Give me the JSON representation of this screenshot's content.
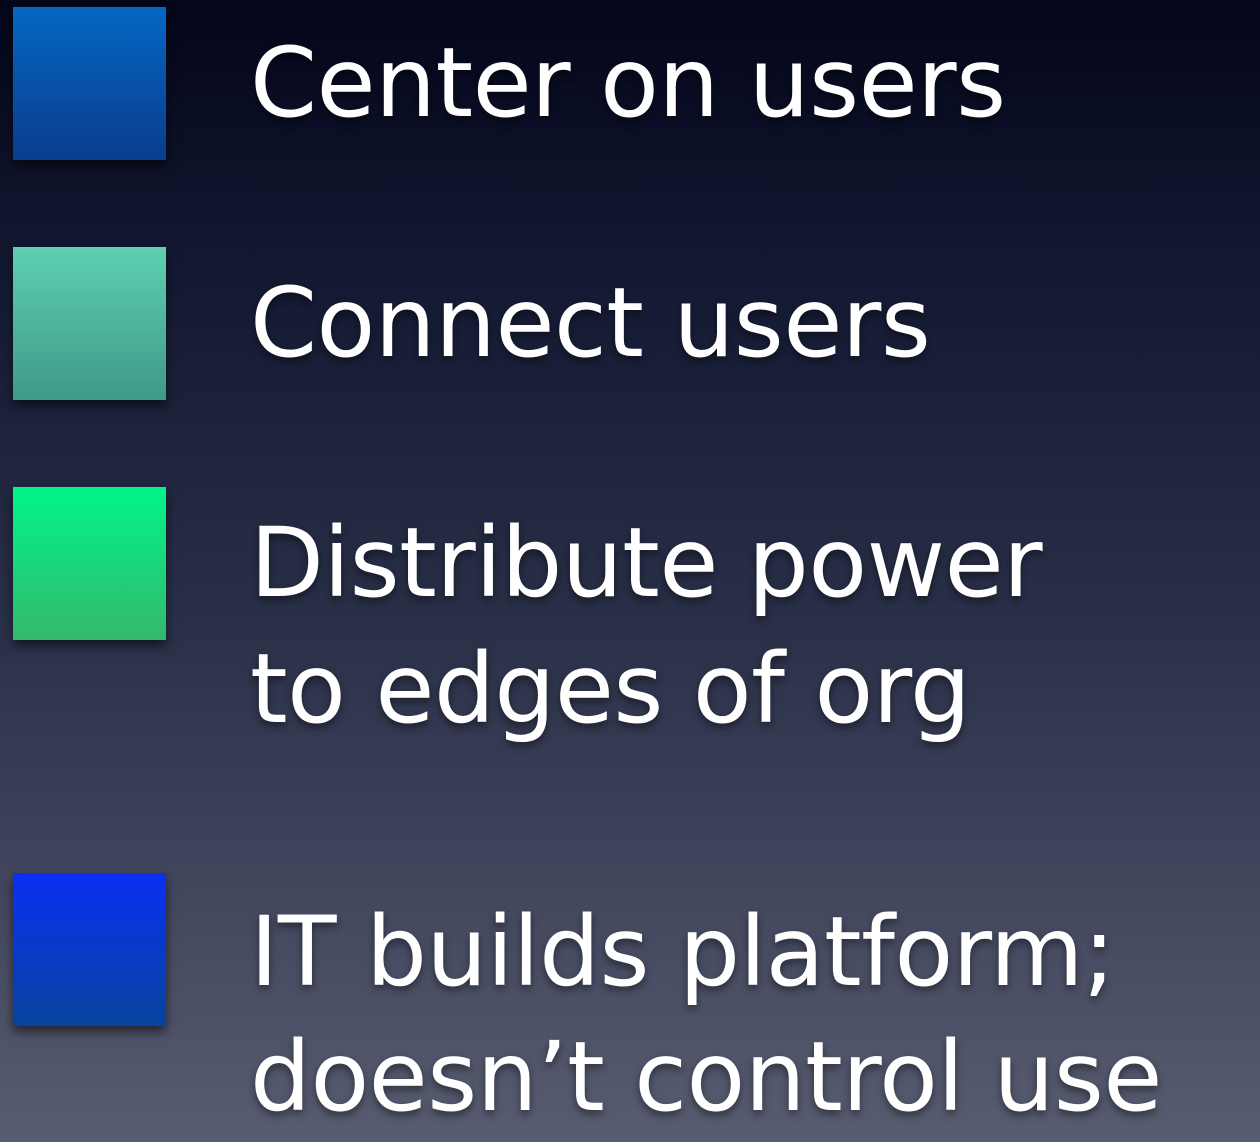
{
  "bullets": [
    {
      "color_top": "#0566c2",
      "color_bottom": "#0a3d8e",
      "lines": [
        "Center on users"
      ]
    },
    {
      "color_top": "#5ecfb0",
      "color_bottom": "#3f9a88",
      "lines": [
        "Connect users"
      ]
    },
    {
      "color_top": "#00f58a",
      "color_bottom": "#34b86c",
      "lines": [
        "Distribute power",
        "to edges of org"
      ]
    },
    {
      "color_top": "#0a2ff2",
      "color_bottom": "#07449e",
      "lines": [
        "IT builds platform;",
        "doesn’t control use"
      ]
    }
  ]
}
